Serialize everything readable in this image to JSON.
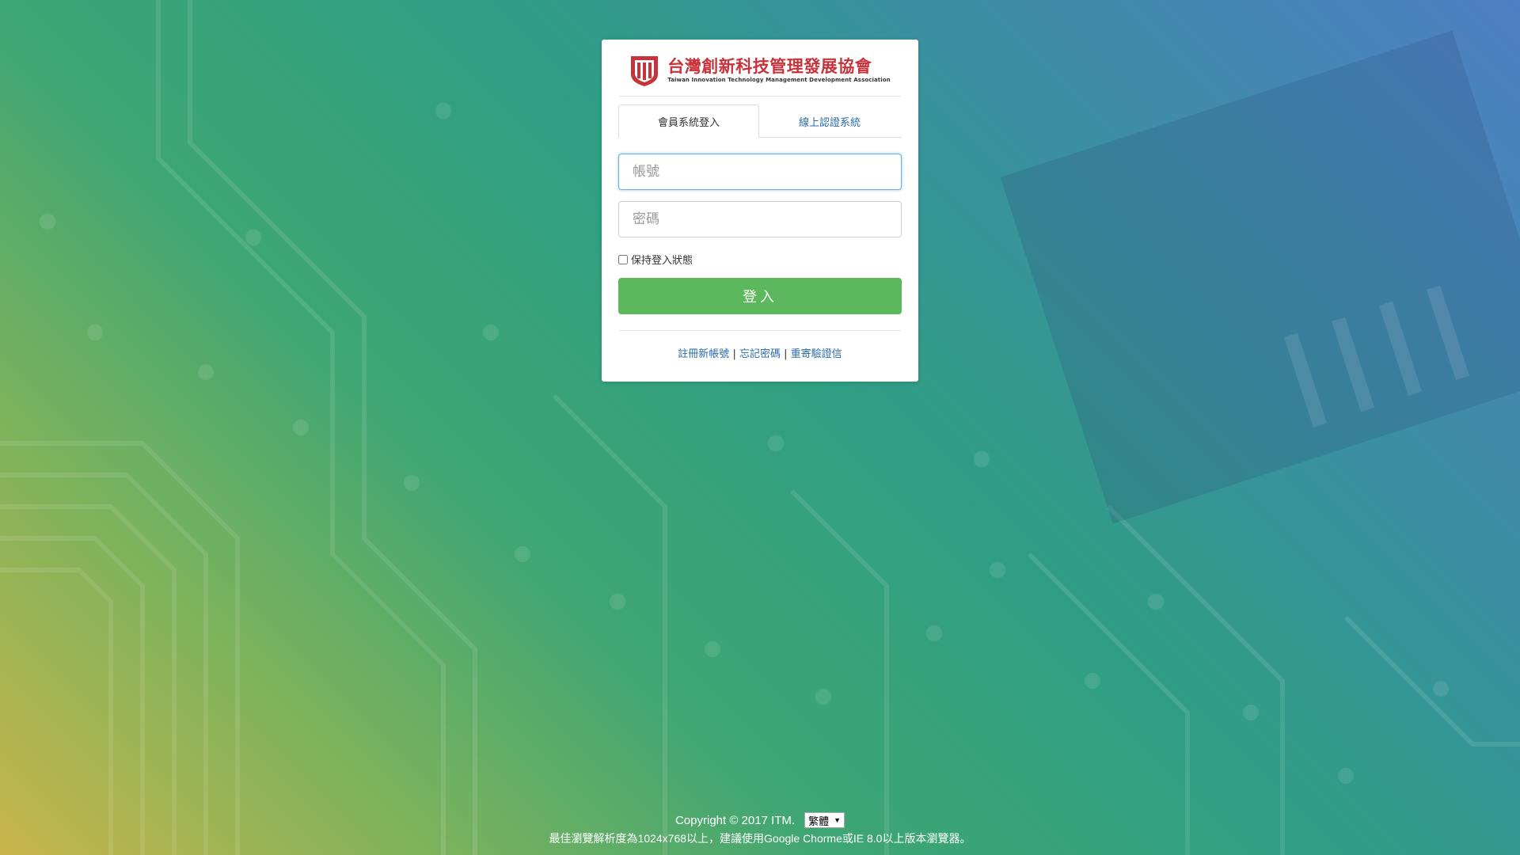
{
  "logo": {
    "name_cn": "台灣創新科技管理發展協會",
    "name_en": "Taiwan Innovation Technology Management Development Association",
    "icon": "itm-shield-logo"
  },
  "tabs": [
    {
      "label": "會員系統登入",
      "active": true
    },
    {
      "label": "線上認證系統",
      "active": false
    }
  ],
  "form": {
    "account_placeholder": "帳號",
    "password_placeholder": "密碼",
    "remember_label": "保持登入狀態",
    "remember_checked": false,
    "login_label": "登入"
  },
  "links": {
    "register": "註冊新帳號",
    "forgot": "忘記密碼",
    "resend": "重寄驗證信",
    "separator": "|"
  },
  "footer": {
    "copyright": "Copyright © 2017 ITM.",
    "language": "繁體",
    "note": "最佳瀏覽解析度為1024x768以上，建議使用Google Chorme或IE 8.0以上版本瀏覽器。"
  },
  "colors": {
    "brand_red": "#c8323a",
    "login_green": "#5cb85c",
    "link_blue": "#2a6aa9"
  }
}
